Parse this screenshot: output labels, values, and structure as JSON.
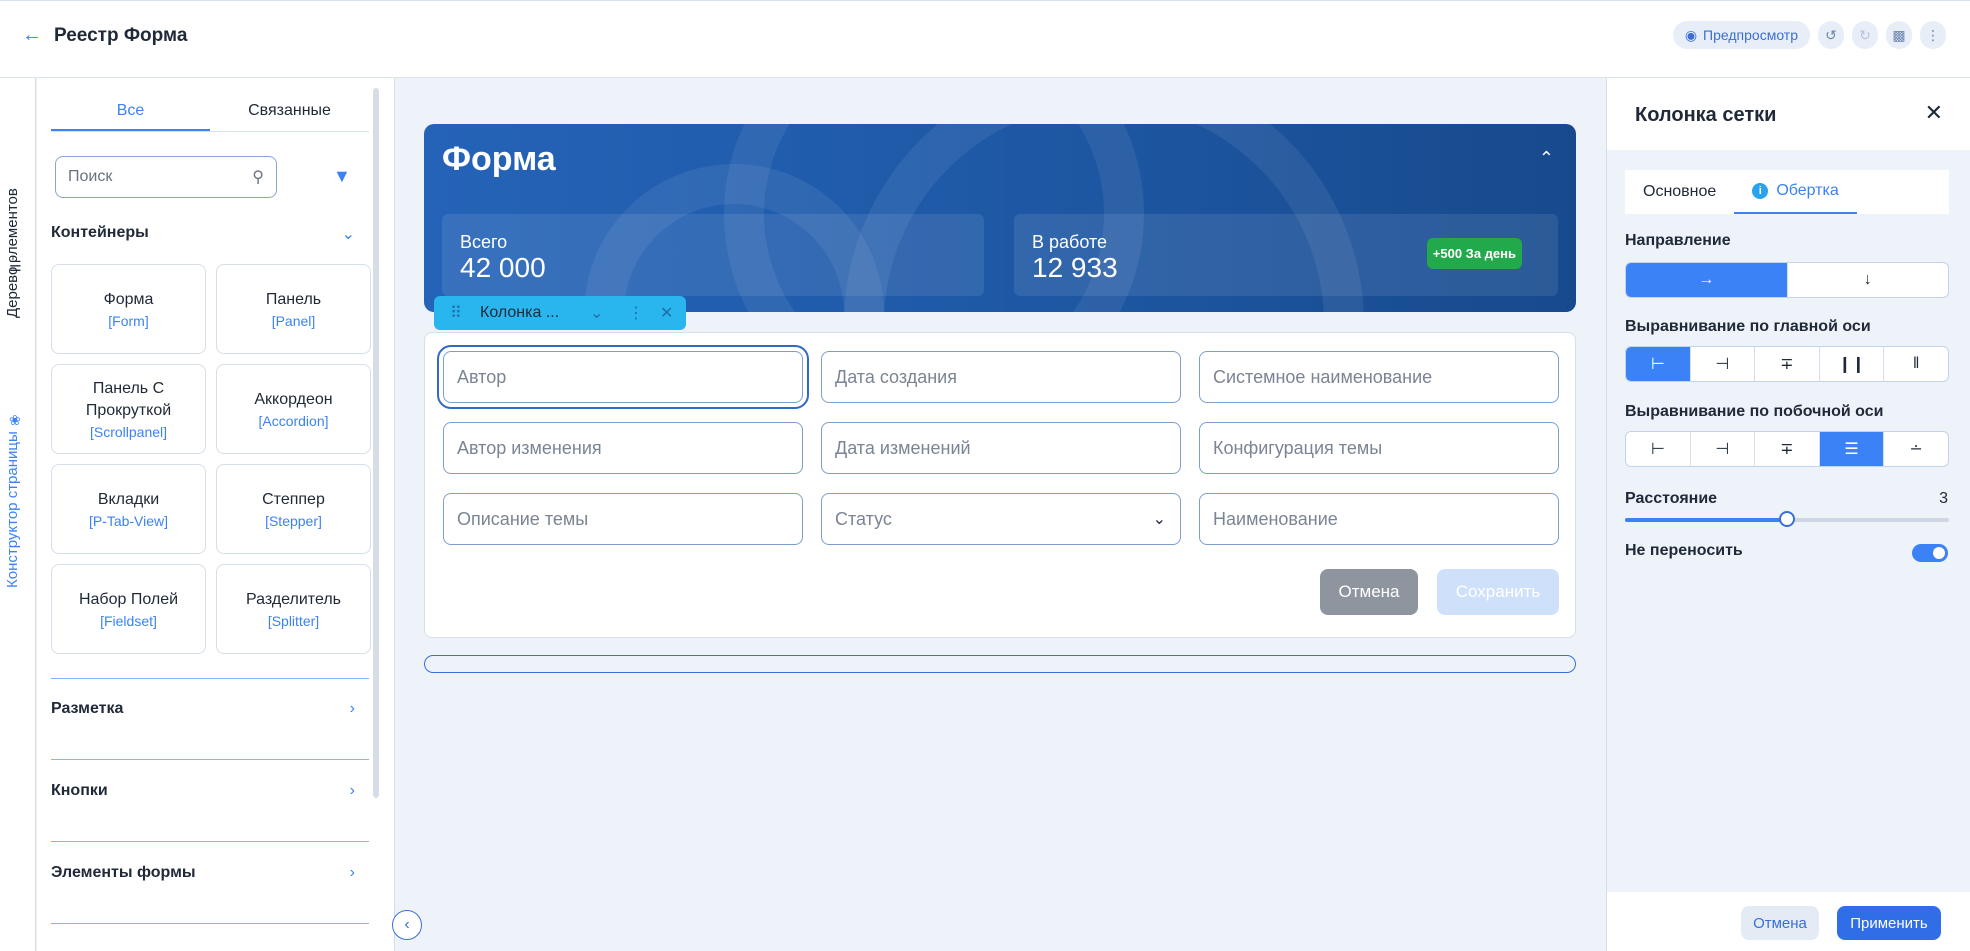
{
  "header": {
    "title": "Реестр Форма",
    "preview_label": "Предпросмотр"
  },
  "vertical_tabs": {
    "tree": "Дерево элементов",
    "builder": "Конструктор страницы"
  },
  "left_panel": {
    "tabs": [
      "Все",
      "Связанные"
    ],
    "search_placeholder": "Поиск",
    "sections": {
      "containers": "Контейнеры",
      "markup": "Разметка",
      "buttons": "Кнопки",
      "form_elements": "Элементы формы"
    },
    "cards": [
      {
        "name": "Форма",
        "code": "[Form]"
      },
      {
        "name": "Панель",
        "code": "[Panel]"
      },
      {
        "name": "Панель С Прокруткой",
        "code": "[Scrollpanel]"
      },
      {
        "name": "Аккордеон",
        "code": "[Accordion]"
      },
      {
        "name": "Вкладки",
        "code": "[P-Tab-View]"
      },
      {
        "name": "Степпер",
        "code": "[Stepper]"
      },
      {
        "name": "Набор Полей",
        "code": "[Fieldset]"
      },
      {
        "name": "Разделитель",
        "code": "[Splitter]"
      }
    ]
  },
  "canvas": {
    "banner": {
      "title": "Форма",
      "stats": [
        {
          "label": "Всего",
          "value": "42 000"
        },
        {
          "label": "В работе",
          "value": "12 933",
          "badge": "+500 За день"
        }
      ]
    },
    "column_tag": "Колонка ...",
    "fields": [
      {
        "placeholder": "Автор"
      },
      {
        "placeholder": "Дата создания"
      },
      {
        "placeholder": "Системное наименование"
      },
      {
        "placeholder": "Автор изменения"
      },
      {
        "placeholder": "Дата изменений"
      },
      {
        "placeholder": "Конфигурация темы"
      },
      {
        "placeholder": "Описание темы"
      },
      {
        "placeholder": "Статус"
      },
      {
        "placeholder": "Наименование"
      }
    ],
    "cancel_label": "Отмена",
    "save_label": "Сохранить"
  },
  "right_panel": {
    "title": "Колонка сетки",
    "tabs": [
      "Основное",
      "Обертка"
    ],
    "direction_label": "Направление",
    "main_axis_label": "Выравнивание по главной оси",
    "cross_axis_label": "Выравнивание по побочной оси",
    "distance_label": "Расстояние",
    "distance_value": "3",
    "distance_fraction": 0.5,
    "nowrap_label": "Не переносить",
    "nowrap_on": true,
    "cancel_label": "Отмена",
    "apply_label": "Применить"
  },
  "colors": {
    "accent": "#3b82f6",
    "banner": "#1f5aa8",
    "badge": "#22a94b",
    "column_tag": "#29b6ef"
  }
}
